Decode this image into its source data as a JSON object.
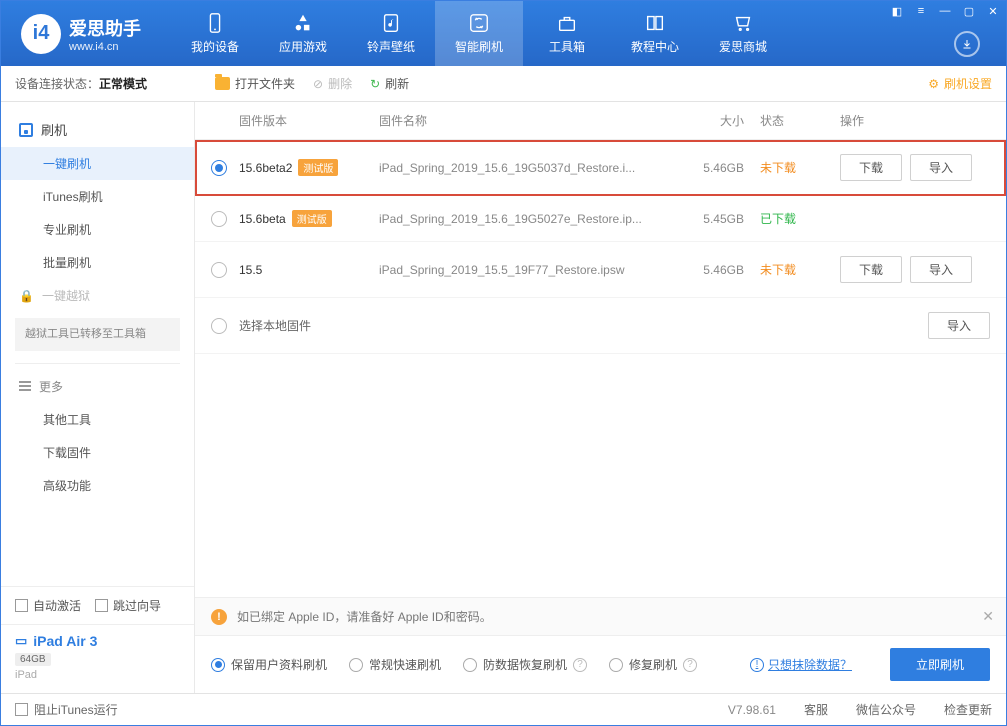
{
  "app": {
    "title": "爱思助手",
    "subtitle": "www.i4.cn"
  },
  "nav": {
    "items": [
      {
        "label": "我的设备"
      },
      {
        "label": "应用游戏"
      },
      {
        "label": "铃声壁纸"
      },
      {
        "label": "智能刷机"
      },
      {
        "label": "工具箱"
      },
      {
        "label": "教程中心"
      },
      {
        "label": "爱思商城"
      }
    ]
  },
  "toolbar": {
    "status_label": "设备连接状态：",
    "status_value": "正常模式",
    "open_folder": "打开文件夹",
    "delete": "删除",
    "refresh": "刷新",
    "settings": "刷机设置"
  },
  "sidebar": {
    "flash": {
      "head": "刷机",
      "items": [
        "一键刷机",
        "iTunes刷机",
        "专业刷机",
        "批量刷机"
      ]
    },
    "jailbreak": {
      "head": "一键越狱",
      "note": "越狱工具已转移至工具箱"
    },
    "more": {
      "head": "更多",
      "items": [
        "其他工具",
        "下载固件",
        "高级功能"
      ]
    },
    "checks": {
      "auto_activate": "自动激活",
      "skip_guide": "跳过向导"
    },
    "device": {
      "name": "iPad Air 3",
      "storage": "64GB",
      "type": "iPad"
    }
  },
  "table": {
    "headers": {
      "version": "固件版本",
      "name": "固件名称",
      "size": "大小",
      "status": "状态",
      "ops": "操作"
    },
    "rows": [
      {
        "version": "15.6beta2",
        "beta": "测试版",
        "name": "iPad_Spring_2019_15.6_19G5037d_Restore.i...",
        "size": "5.46GB",
        "status": "未下载",
        "status_class": "st-not",
        "selected": true,
        "highlighted": true,
        "show_download": true,
        "show_import": true
      },
      {
        "version": "15.6beta",
        "beta": "测试版",
        "name": "iPad_Spring_2019_15.6_19G5027e_Restore.ip...",
        "size": "5.45GB",
        "status": "已下载",
        "status_class": "st-done",
        "selected": false,
        "show_download": false,
        "show_import": false
      },
      {
        "version": "15.5",
        "beta": "",
        "name": "iPad_Spring_2019_15.5_19F77_Restore.ipsw",
        "size": "5.46GB",
        "status": "未下载",
        "status_class": "st-not",
        "selected": false,
        "show_download": true,
        "show_import": true
      },
      {
        "version": "",
        "beta": "",
        "name": "选择本地固件",
        "size": "",
        "status": "",
        "status_class": "",
        "selected": false,
        "local": true
      }
    ],
    "btn_download": "下载",
    "btn_import": "导入"
  },
  "info_strip": "如已绑定 Apple ID，请准备好 Apple ID和密码。",
  "flash_options": {
    "opts": [
      {
        "label": "保留用户资料刷机",
        "sel": true,
        "help": false
      },
      {
        "label": "常规快速刷机",
        "sel": false,
        "help": false
      },
      {
        "label": "防数据恢复刷机",
        "sel": false,
        "help": true
      },
      {
        "label": "修复刷机",
        "sel": false,
        "help": true
      }
    ],
    "erase_link": "只想抹除数据？",
    "flash_now": "立即刷机"
  },
  "footer": {
    "block_itunes": "阻止iTunes运行",
    "version": "V7.98.61",
    "support": "客服",
    "wechat": "微信公众号",
    "check_update": "检查更新"
  }
}
